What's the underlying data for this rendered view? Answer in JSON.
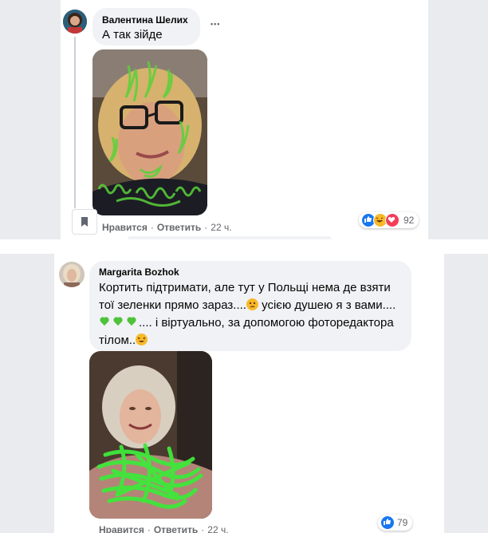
{
  "comments": [
    {
      "author": "Валентина Шелих",
      "text": "А так зійде",
      "more": "•••",
      "actions": {
        "like": "Нравится",
        "sep1": "·",
        "reply": "Ответить",
        "sep2": "·",
        "time": "22 ч."
      },
      "reactions": {
        "count": "92",
        "icons": [
          "like-icon",
          "haha-icon",
          "love-icon"
        ]
      }
    },
    {
      "author": "Margarita Bozhok",
      "text_lines": [
        "Кортить підтримати, але тут у Польщі нема де взяти",
        "тої зеленки прямо зараз....",
        " усією душею я з вами....",
        ".... і віртуально, за допомогою фоторедактора",
        "тілом.."
      ],
      "actions": {
        "like": "Нравится",
        "sep1": "·",
        "reply": "Ответить",
        "sep2": "·",
        "time": "22 ч."
      },
      "reactions": {
        "count": "79",
        "icons": [
          "like-icon"
        ]
      }
    }
  ],
  "colors": {
    "bubble": "#f0f2f5",
    "side": "#e9ebee",
    "like_blue": "#1877f2",
    "love_red": "#f33e58",
    "haha_yellow": "#f7b928",
    "green_marker": "#4ec23a"
  }
}
